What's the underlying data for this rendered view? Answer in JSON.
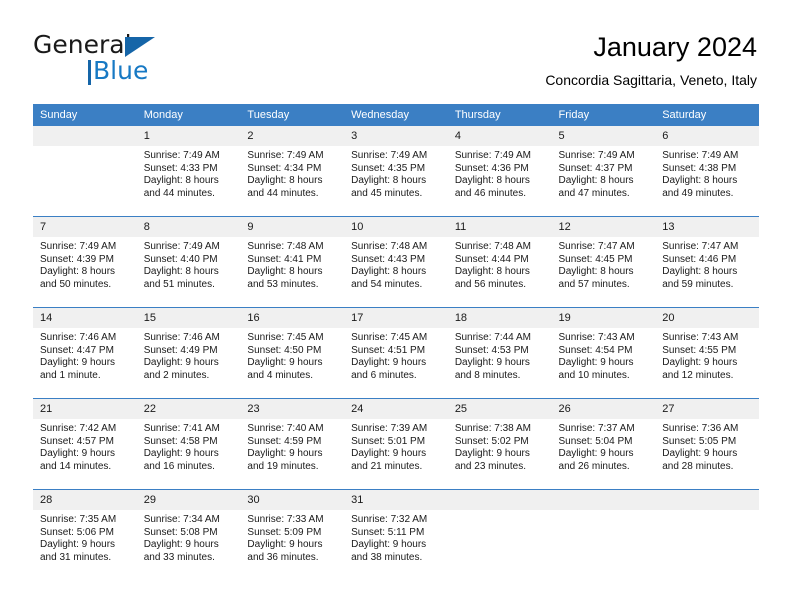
{
  "brand": {
    "name_part1": "General",
    "name_part2": "Blue",
    "accent_color": "#1779c4",
    "triangle_color": "#1565a8"
  },
  "header": {
    "title": "January 2024",
    "subtitle": "Concordia Sagittaria, Veneto, Italy",
    "header_bg_color": "#3b7fc4",
    "daynum_bg_color": "#f0f0f0"
  },
  "weekday_headers": [
    "Sunday",
    "Monday",
    "Tuesday",
    "Wednesday",
    "Thursday",
    "Friday",
    "Saturday"
  ],
  "weeks": [
    [
      {
        "day": "",
        "sunrise": "",
        "sunset": "",
        "daylight_line1": "",
        "daylight_line2": ""
      },
      {
        "day": "1",
        "sunrise": "Sunrise: 7:49 AM",
        "sunset": "Sunset: 4:33 PM",
        "daylight_line1": "Daylight: 8 hours",
        "daylight_line2": "and 44 minutes."
      },
      {
        "day": "2",
        "sunrise": "Sunrise: 7:49 AM",
        "sunset": "Sunset: 4:34 PM",
        "daylight_line1": "Daylight: 8 hours",
        "daylight_line2": "and 44 minutes."
      },
      {
        "day": "3",
        "sunrise": "Sunrise: 7:49 AM",
        "sunset": "Sunset: 4:35 PM",
        "daylight_line1": "Daylight: 8 hours",
        "daylight_line2": "and 45 minutes."
      },
      {
        "day": "4",
        "sunrise": "Sunrise: 7:49 AM",
        "sunset": "Sunset: 4:36 PM",
        "daylight_line1": "Daylight: 8 hours",
        "daylight_line2": "and 46 minutes."
      },
      {
        "day": "5",
        "sunrise": "Sunrise: 7:49 AM",
        "sunset": "Sunset: 4:37 PM",
        "daylight_line1": "Daylight: 8 hours",
        "daylight_line2": "and 47 minutes."
      },
      {
        "day": "6",
        "sunrise": "Sunrise: 7:49 AM",
        "sunset": "Sunset: 4:38 PM",
        "daylight_line1": "Daylight: 8 hours",
        "daylight_line2": "and 49 minutes."
      }
    ],
    [
      {
        "day": "7",
        "sunrise": "Sunrise: 7:49 AM",
        "sunset": "Sunset: 4:39 PM",
        "daylight_line1": "Daylight: 8 hours",
        "daylight_line2": "and 50 minutes."
      },
      {
        "day": "8",
        "sunrise": "Sunrise: 7:49 AM",
        "sunset": "Sunset: 4:40 PM",
        "daylight_line1": "Daylight: 8 hours",
        "daylight_line2": "and 51 minutes."
      },
      {
        "day": "9",
        "sunrise": "Sunrise: 7:48 AM",
        "sunset": "Sunset: 4:41 PM",
        "daylight_line1": "Daylight: 8 hours",
        "daylight_line2": "and 53 minutes."
      },
      {
        "day": "10",
        "sunrise": "Sunrise: 7:48 AM",
        "sunset": "Sunset: 4:43 PM",
        "daylight_line1": "Daylight: 8 hours",
        "daylight_line2": "and 54 minutes."
      },
      {
        "day": "11",
        "sunrise": "Sunrise: 7:48 AM",
        "sunset": "Sunset: 4:44 PM",
        "daylight_line1": "Daylight: 8 hours",
        "daylight_line2": "and 56 minutes."
      },
      {
        "day": "12",
        "sunrise": "Sunrise: 7:47 AM",
        "sunset": "Sunset: 4:45 PM",
        "daylight_line1": "Daylight: 8 hours",
        "daylight_line2": "and 57 minutes."
      },
      {
        "day": "13",
        "sunrise": "Sunrise: 7:47 AM",
        "sunset": "Sunset: 4:46 PM",
        "daylight_line1": "Daylight: 8 hours",
        "daylight_line2": "and 59 minutes."
      }
    ],
    [
      {
        "day": "14",
        "sunrise": "Sunrise: 7:46 AM",
        "sunset": "Sunset: 4:47 PM",
        "daylight_line1": "Daylight: 9 hours",
        "daylight_line2": "and 1 minute."
      },
      {
        "day": "15",
        "sunrise": "Sunrise: 7:46 AM",
        "sunset": "Sunset: 4:49 PM",
        "daylight_line1": "Daylight: 9 hours",
        "daylight_line2": "and 2 minutes."
      },
      {
        "day": "16",
        "sunrise": "Sunrise: 7:45 AM",
        "sunset": "Sunset: 4:50 PM",
        "daylight_line1": "Daylight: 9 hours",
        "daylight_line2": "and 4 minutes."
      },
      {
        "day": "17",
        "sunrise": "Sunrise: 7:45 AM",
        "sunset": "Sunset: 4:51 PM",
        "daylight_line1": "Daylight: 9 hours",
        "daylight_line2": "and 6 minutes."
      },
      {
        "day": "18",
        "sunrise": "Sunrise: 7:44 AM",
        "sunset": "Sunset: 4:53 PM",
        "daylight_line1": "Daylight: 9 hours",
        "daylight_line2": "and 8 minutes."
      },
      {
        "day": "19",
        "sunrise": "Sunrise: 7:43 AM",
        "sunset": "Sunset: 4:54 PM",
        "daylight_line1": "Daylight: 9 hours",
        "daylight_line2": "and 10 minutes."
      },
      {
        "day": "20",
        "sunrise": "Sunrise: 7:43 AM",
        "sunset": "Sunset: 4:55 PM",
        "daylight_line1": "Daylight: 9 hours",
        "daylight_line2": "and 12 minutes."
      }
    ],
    [
      {
        "day": "21",
        "sunrise": "Sunrise: 7:42 AM",
        "sunset": "Sunset: 4:57 PM",
        "daylight_line1": "Daylight: 9 hours",
        "daylight_line2": "and 14 minutes."
      },
      {
        "day": "22",
        "sunrise": "Sunrise: 7:41 AM",
        "sunset": "Sunset: 4:58 PM",
        "daylight_line1": "Daylight: 9 hours",
        "daylight_line2": "and 16 minutes."
      },
      {
        "day": "23",
        "sunrise": "Sunrise: 7:40 AM",
        "sunset": "Sunset: 4:59 PM",
        "daylight_line1": "Daylight: 9 hours",
        "daylight_line2": "and 19 minutes."
      },
      {
        "day": "24",
        "sunrise": "Sunrise: 7:39 AM",
        "sunset": "Sunset: 5:01 PM",
        "daylight_line1": "Daylight: 9 hours",
        "daylight_line2": "and 21 minutes."
      },
      {
        "day": "25",
        "sunrise": "Sunrise: 7:38 AM",
        "sunset": "Sunset: 5:02 PM",
        "daylight_line1": "Daylight: 9 hours",
        "daylight_line2": "and 23 minutes."
      },
      {
        "day": "26",
        "sunrise": "Sunrise: 7:37 AM",
        "sunset": "Sunset: 5:04 PM",
        "daylight_line1": "Daylight: 9 hours",
        "daylight_line2": "and 26 minutes."
      },
      {
        "day": "27",
        "sunrise": "Sunrise: 7:36 AM",
        "sunset": "Sunset: 5:05 PM",
        "daylight_line1": "Daylight: 9 hours",
        "daylight_line2": "and 28 minutes."
      }
    ],
    [
      {
        "day": "28",
        "sunrise": "Sunrise: 7:35 AM",
        "sunset": "Sunset: 5:06 PM",
        "daylight_line1": "Daylight: 9 hours",
        "daylight_line2": "and 31 minutes."
      },
      {
        "day": "29",
        "sunrise": "Sunrise: 7:34 AM",
        "sunset": "Sunset: 5:08 PM",
        "daylight_line1": "Daylight: 9 hours",
        "daylight_line2": "and 33 minutes."
      },
      {
        "day": "30",
        "sunrise": "Sunrise: 7:33 AM",
        "sunset": "Sunset: 5:09 PM",
        "daylight_line1": "Daylight: 9 hours",
        "daylight_line2": "and 36 minutes."
      },
      {
        "day": "31",
        "sunrise": "Sunrise: 7:32 AM",
        "sunset": "Sunset: 5:11 PM",
        "daylight_line1": "Daylight: 9 hours",
        "daylight_line2": "and 38 minutes."
      },
      {
        "day": "",
        "sunrise": "",
        "sunset": "",
        "daylight_line1": "",
        "daylight_line2": ""
      },
      {
        "day": "",
        "sunrise": "",
        "sunset": "",
        "daylight_line1": "",
        "daylight_line2": ""
      },
      {
        "day": "",
        "sunrise": "",
        "sunset": "",
        "daylight_line1": "",
        "daylight_line2": ""
      }
    ]
  ]
}
